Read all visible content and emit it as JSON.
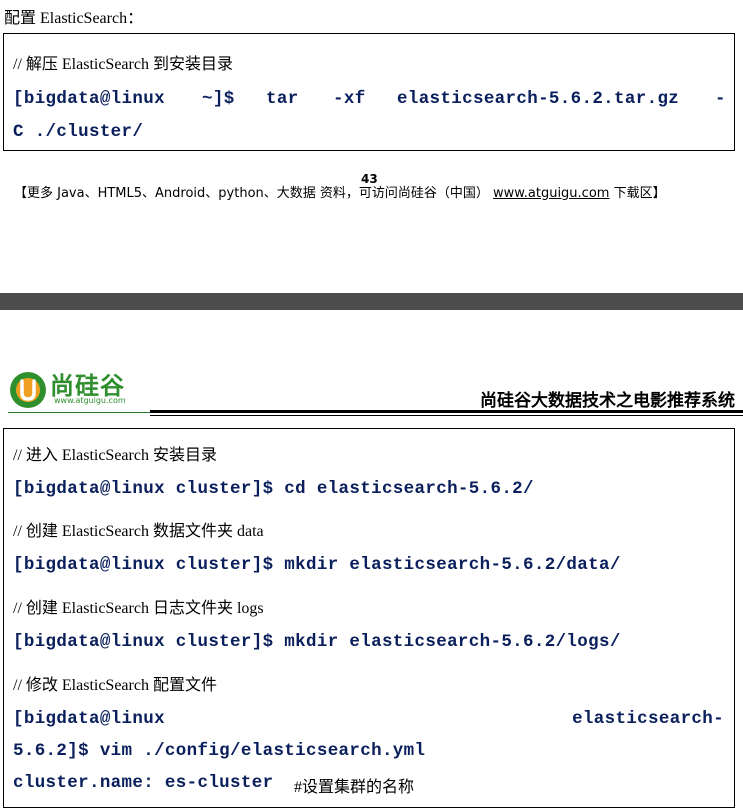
{
  "section_title": "配置 ElasticSearch：",
  "box1": {
    "comment": "// 解压 ElasticSearch 到安装目录",
    "cmd_parts": [
      "[bigdata@linux",
      "~]$",
      "tar",
      "-xf",
      "elasticsearch-5.6.2.tar.gz",
      "-"
    ],
    "cmd_line2": "C ./cluster/"
  },
  "footer": {
    "prefix": "【更多 Java、HTML5、Android、python、大数据 资料，可访问尚硅谷（中国） ",
    "url": "www.atguigu.com",
    "suffix": " 下载区】",
    "page_number": "43"
  },
  "header": {
    "logo_text": "尚硅谷",
    "logo_url": "www.atguigu.com",
    "title": "尚硅谷大数据技术之电影推荐系统"
  },
  "box2": {
    "lines": [
      {
        "kind": "comment",
        "text": "// 进入 ElasticSearch 安装目录"
      },
      {
        "kind": "cmd",
        "text": "[bigdata@linux cluster]$ cd elasticsearch-5.6.2/"
      },
      {
        "kind": "comment",
        "text": "// 创建 ElasticSearch 数据文件夹 data"
      },
      {
        "kind": "cmd",
        "text": "[bigdata@linux cluster]$ mkdir elasticsearch-5.6.2/data/"
      },
      {
        "kind": "comment",
        "text": "// 创建 ElasticSearch 日志文件夹 logs"
      },
      {
        "kind": "cmd",
        "text": "[bigdata@linux cluster]$ mkdir elasticsearch-5.6.2/logs/"
      },
      {
        "kind": "comment",
        "text": "// 修改 ElasticSearch 配置文件"
      }
    ],
    "split_cmd_left": "[bigdata@linux",
    "split_cmd_right": "elasticsearch-",
    "split_cmd_line2": "5.6.2]$ vim ./config/elasticsearch.yml",
    "config_key": "cluster.name: es-cluster",
    "config_comment": "#设置集群的名称"
  },
  "colors": {
    "code_text": "#0a1f5c",
    "divider": "#4c4c4c",
    "logo_green": "#2f8f2f",
    "logo_orange": "#f0a020"
  }
}
